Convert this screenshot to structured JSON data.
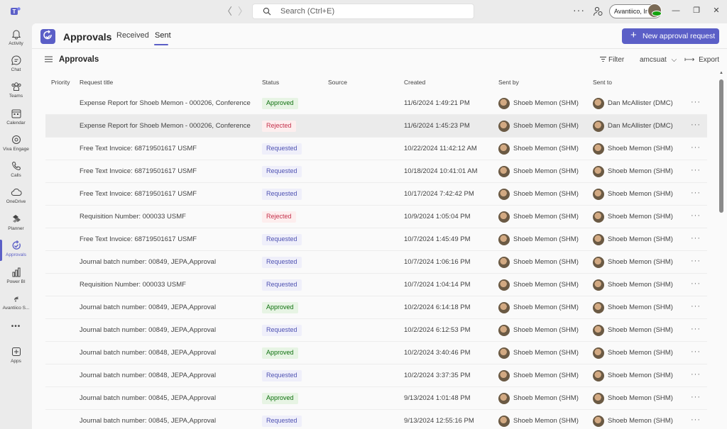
{
  "titlebar": {
    "search_placeholder": "Search (Ctrl+E)",
    "org_name": "Avantiico, Inc",
    "back_glyph": "〈",
    "forward_glyph": "〉",
    "more_glyph": "···",
    "minimize_glyph": "—",
    "restore_glyph": "❐",
    "close_glyph": "✕"
  },
  "rail": {
    "items": [
      {
        "label": "Activity",
        "icon": "bell-icon"
      },
      {
        "label": "Chat",
        "icon": "chat-icon"
      },
      {
        "label": "Teams",
        "icon": "teams-icon"
      },
      {
        "label": "Calendar",
        "icon": "calendar-icon"
      },
      {
        "label": "Viva Engage",
        "icon": "viva-engage-icon"
      },
      {
        "label": "Calls",
        "icon": "phone-icon"
      },
      {
        "label": "OneDrive",
        "icon": "cloud-icon"
      },
      {
        "label": "Planner",
        "icon": "planner-icon"
      },
      {
        "label": "Approvals",
        "icon": "approvals-icon"
      },
      {
        "label": "Power BI",
        "icon": "power-bi-icon"
      },
      {
        "label": "Avantiico S...",
        "icon": "avantiico-icon"
      },
      {
        "label": "Apps",
        "icon": "apps-icon"
      }
    ],
    "more_glyph": "•••"
  },
  "header": {
    "title": "Approvals",
    "tabs": [
      "Received",
      "Sent"
    ],
    "new_button": "New approval request",
    "plus_glyph": "+"
  },
  "subheader": {
    "title": "Approvals",
    "filter": "Filter",
    "environment": "amcsuat",
    "export": "Export",
    "chevron_glyph": "⌵",
    "export_glyph": "⟼"
  },
  "table": {
    "columns": [
      "Priority",
      "Request title",
      "Status",
      "Source",
      "Created",
      "Sent by",
      "Sent to"
    ],
    "more_glyph": "···",
    "rows": [
      {
        "title": "Expense Report for Shoeb Memon - 000206, Conference",
        "status": "Approved",
        "created": "11/6/2024 1:49:21 PM",
        "sent_by": "Shoeb Memon (SHM)",
        "sent_to": "Dan McAllister (DMC)"
      },
      {
        "title": "Expense Report for Shoeb Memon - 000206, Conference",
        "status": "Rejected",
        "created": "11/6/2024 1:45:23 PM",
        "sent_by": "Shoeb Memon (SHM)",
        "sent_to": "Dan McAllister (DMC)"
      },
      {
        "title": "Free Text Invoice: 68719501617 USMF",
        "status": "Requested",
        "created": "10/22/2024 11:42:12 AM",
        "sent_by": "Shoeb Memon (SHM)",
        "sent_to": "Shoeb Memon (SHM)"
      },
      {
        "title": "Free Text Invoice: 68719501617 USMF",
        "status": "Requested",
        "created": "10/18/2024 10:41:01 AM",
        "sent_by": "Shoeb Memon (SHM)",
        "sent_to": "Shoeb Memon (SHM)"
      },
      {
        "title": "Free Text Invoice: 68719501617 USMF",
        "status": "Requested",
        "created": "10/17/2024 7:42:42 PM",
        "sent_by": "Shoeb Memon (SHM)",
        "sent_to": "Shoeb Memon (SHM)"
      },
      {
        "title": "Requisition Number: 000033 USMF",
        "status": "Rejected",
        "created": "10/9/2024 1:05:04 PM",
        "sent_by": "Shoeb Memon (SHM)",
        "sent_to": "Shoeb Memon (SHM)"
      },
      {
        "title": "Free Text Invoice: 68719501617 USMF",
        "status": "Requested",
        "created": "10/7/2024 1:45:49 PM",
        "sent_by": "Shoeb Memon (SHM)",
        "sent_to": "Shoeb Memon (SHM)"
      },
      {
        "title": "Journal batch number: 00849, JEPA,Approval",
        "status": "Requested",
        "created": "10/7/2024 1:06:16 PM",
        "sent_by": "Shoeb Memon (SHM)",
        "sent_to": "Shoeb Memon (SHM)"
      },
      {
        "title": "Requisition Number: 000033 USMF",
        "status": "Requested",
        "created": "10/7/2024 1:04:14 PM",
        "sent_by": "Shoeb Memon (SHM)",
        "sent_to": "Shoeb Memon (SHM)"
      },
      {
        "title": "Journal batch number: 00849, JEPA,Approval",
        "status": "Approved",
        "created": "10/2/2024 6:14:18 PM",
        "sent_by": "Shoeb Memon (SHM)",
        "sent_to": "Shoeb Memon (SHM)"
      },
      {
        "title": "Journal batch number: 00849, JEPA,Approval",
        "status": "Requested",
        "created": "10/2/2024 6:12:53 PM",
        "sent_by": "Shoeb Memon (SHM)",
        "sent_to": "Shoeb Memon (SHM)"
      },
      {
        "title": "Journal batch number: 00848, JEPA,Approval",
        "status": "Approved",
        "created": "10/2/2024 3:40:46 PM",
        "sent_by": "Shoeb Memon (SHM)",
        "sent_to": "Shoeb Memon (SHM)"
      },
      {
        "title": "Journal batch number: 00848, JEPA,Approval",
        "status": "Requested",
        "created": "10/2/2024 3:37:35 PM",
        "sent_by": "Shoeb Memon (SHM)",
        "sent_to": "Shoeb Memon (SHM)"
      },
      {
        "title": "Journal batch number: 00845, JEPA,Approval",
        "status": "Approved",
        "created": "9/13/2024 1:01:48 PM",
        "sent_by": "Shoeb Memon (SHM)",
        "sent_to": "Shoeb Memon (SHM)"
      },
      {
        "title": "Journal batch number: 00845, JEPA,Approval",
        "status": "Requested",
        "created": "9/13/2024 12:55:16 PM",
        "sent_by": "Shoeb Memon (SHM)",
        "sent_to": "Shoeb Memon (SHM)"
      }
    ]
  },
  "colors": {
    "accent": "#5b5fc7",
    "approved": "#0e700e",
    "rejected": "#c4314b",
    "requested": "#4f52b2"
  }
}
